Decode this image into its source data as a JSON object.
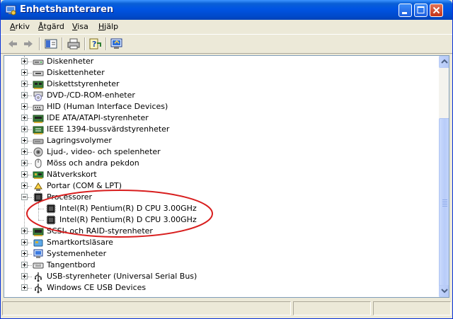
{
  "window": {
    "title": "Enhetshanteraren"
  },
  "menu": [
    {
      "label": "Arkiv",
      "key": "A",
      "rest": "rkiv"
    },
    {
      "label": "Åtgärd",
      "key": "Å",
      "rest": "tgärd"
    },
    {
      "label": "Visa",
      "key": "V",
      "rest": "isa"
    },
    {
      "label": "Hjälp",
      "key": "H",
      "rest": "jälp"
    }
  ],
  "tree": {
    "items": [
      {
        "label": "Diskenheter",
        "icon": "disk-drive-icon"
      },
      {
        "label": "Diskettenheter",
        "icon": "floppy-drive-icon"
      },
      {
        "label": "Diskettstyrenheter",
        "icon": "floppy-controller-icon"
      },
      {
        "label": "DVD-/CD-ROM-enheter",
        "icon": "cd-rom-icon"
      },
      {
        "label": "HID (Human Interface Devices)",
        "icon": "hid-icon"
      },
      {
        "label": "IDE ATA/ATAPI-styrenheter",
        "icon": "ide-controller-icon"
      },
      {
        "label": "IEEE 1394-bussvärdstyrenheter",
        "icon": "firewire-icon"
      },
      {
        "label": "Lagringsvolymer",
        "icon": "storage-volume-icon"
      },
      {
        "label": "Ljud-, video- och spelenheter",
        "icon": "sound-icon"
      },
      {
        "label": "Möss och andra pekdon",
        "icon": "mouse-icon"
      },
      {
        "label": "Nätverkskort",
        "icon": "network-card-icon"
      },
      {
        "label": "Portar (COM & LPT)",
        "icon": "port-icon"
      },
      {
        "label": "Processorer",
        "icon": "processor-icon",
        "expanded": true,
        "children": [
          {
            "label": "Intel(R) Pentium(R) D CPU 3.00GHz",
            "icon": "processor-icon"
          },
          {
            "label": "Intel(R) Pentium(R) D CPU 3.00GHz",
            "icon": "processor-icon"
          }
        ]
      },
      {
        "label": "SCSI- och RAID-styrenheter",
        "icon": "scsi-icon"
      },
      {
        "label": "Smartkortsläsare",
        "icon": "smartcard-icon"
      },
      {
        "label": "Systemenheter",
        "icon": "system-device-icon"
      },
      {
        "label": "Tangentbord",
        "icon": "keyboard-icon"
      },
      {
        "label": "USB-styrenheter (Universal Serial Bus)",
        "icon": "usb-icon"
      },
      {
        "label": "Windows CE USB Devices",
        "icon": "usb-icon"
      }
    ]
  },
  "colors": {
    "titlebar": "#0054E3",
    "annotation": "#D81E1E",
    "window_bg": "#ECE9D8"
  }
}
